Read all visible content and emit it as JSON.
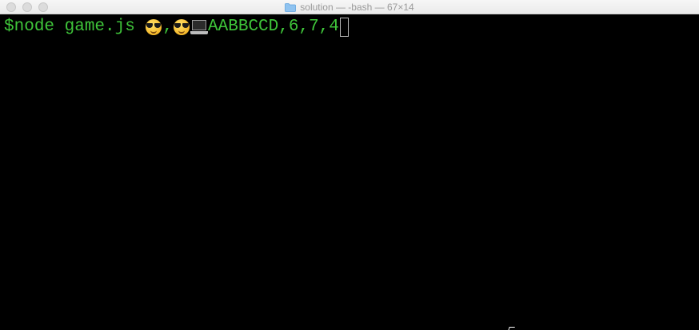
{
  "window": {
    "title": "solution — -bash — 67×14",
    "icon": "folder-icon",
    "traffic_lights": [
      "close",
      "minimize",
      "zoom"
    ]
  },
  "terminal": {
    "prompt": "$",
    "command": "node game.js ",
    "emoji_1": "cool-sunglasses-emoji",
    "separator": ",",
    "emoji_2": "cool-sunglasses-emoji",
    "emoji_3": "laptop-computer-emoji",
    "output": "AABBCCD,6,7,4",
    "text_color": "#3fc53a",
    "background": "#000000"
  }
}
